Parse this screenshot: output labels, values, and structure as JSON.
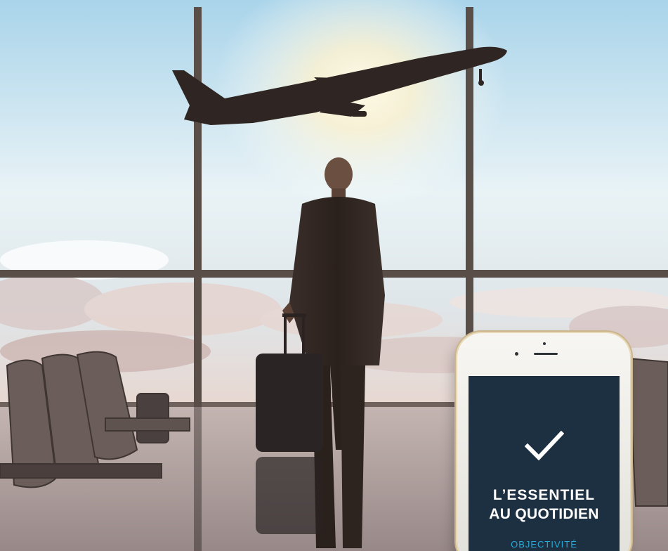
{
  "scene": {
    "subject": "businessman with suitcase at airport window watching airplane take off",
    "window_frame_color": "#5a4e48",
    "sky_top_color": "#bfe0ef",
    "sun_color": "#fff2c8"
  },
  "phone": {
    "body_color": "#f1f0eb",
    "bezel_color": "#d9c59f",
    "screen_color": "#1c3042",
    "icon": "check-icon",
    "headline_line1": "L’ESSENTIEL",
    "headline_line2": "AU QUOTIDIEN",
    "tagline": "OBJECTIVITÉ",
    "tagline_color": "#29a9d6"
  }
}
